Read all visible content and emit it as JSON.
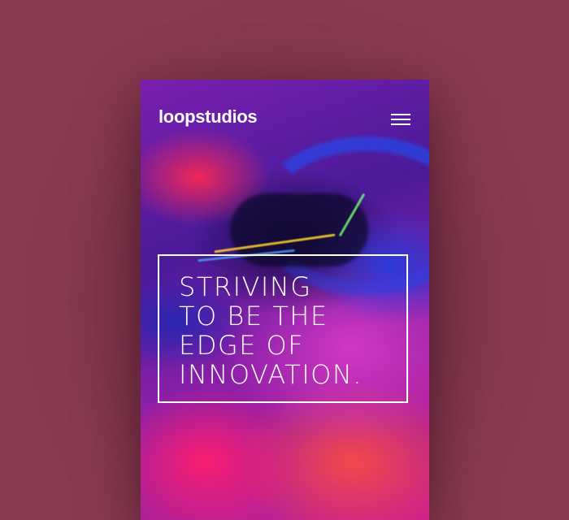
{
  "app": {
    "brand": "loopstudios"
  },
  "header": {
    "logo_text": "loopstudios",
    "menu_icon": "hamburger-menu-icon"
  },
  "hero": {
    "headline_lines": [
      "STRIVING",
      "TO BE THE",
      "EDGE OF",
      "INNOVATION."
    ],
    "image_description_icon": "vr-headset-photo"
  },
  "colors": {
    "page_background": "#8a3a4f",
    "text": "#ffffff",
    "hero_purple": "#7a1fb0",
    "hero_pink": "#d0208a",
    "hero_blue": "#2840e6"
  }
}
